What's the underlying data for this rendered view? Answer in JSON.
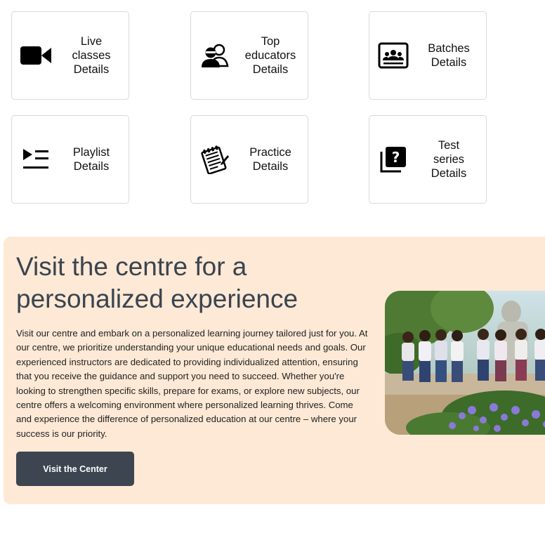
{
  "cards": [
    {
      "label": "Live\nclasses\nDetails",
      "icon": "video-camera-icon"
    },
    {
      "label": "Top\neducators\nDetails",
      "icon": "educators-icon"
    },
    {
      "label": "Batches\nDetails",
      "icon": "batches-icon"
    },
    {
      "label": "Playlist\nDetails",
      "icon": "playlist-icon"
    },
    {
      "label": "Practice\nDetails",
      "icon": "practice-notepad-icon"
    },
    {
      "label": "Test\nseries\nDetails",
      "icon": "question-quiz-icon"
    }
  ],
  "promo": {
    "title": "Visit the centre for a personalized experience",
    "body": "Visit our centre and embark on a personalized learning journey tailored just for you. At our centre, we prioritize understanding your unique educational needs and goals. Our experienced instructors are dedicated to providing individualized attention, ensuring that you receive the guidance and support you need to succeed. Whether you're looking to strengthen specific skills, prepare for exams, or explore new subjects, our centre offers a welcoming environment where personalized learning thrives. Come and experience the difference of personalized education at our centre – where your success is our priority.",
    "button_label": "Visit the Center",
    "background_color": "#fde9d5",
    "button_color": "#3d4550"
  }
}
